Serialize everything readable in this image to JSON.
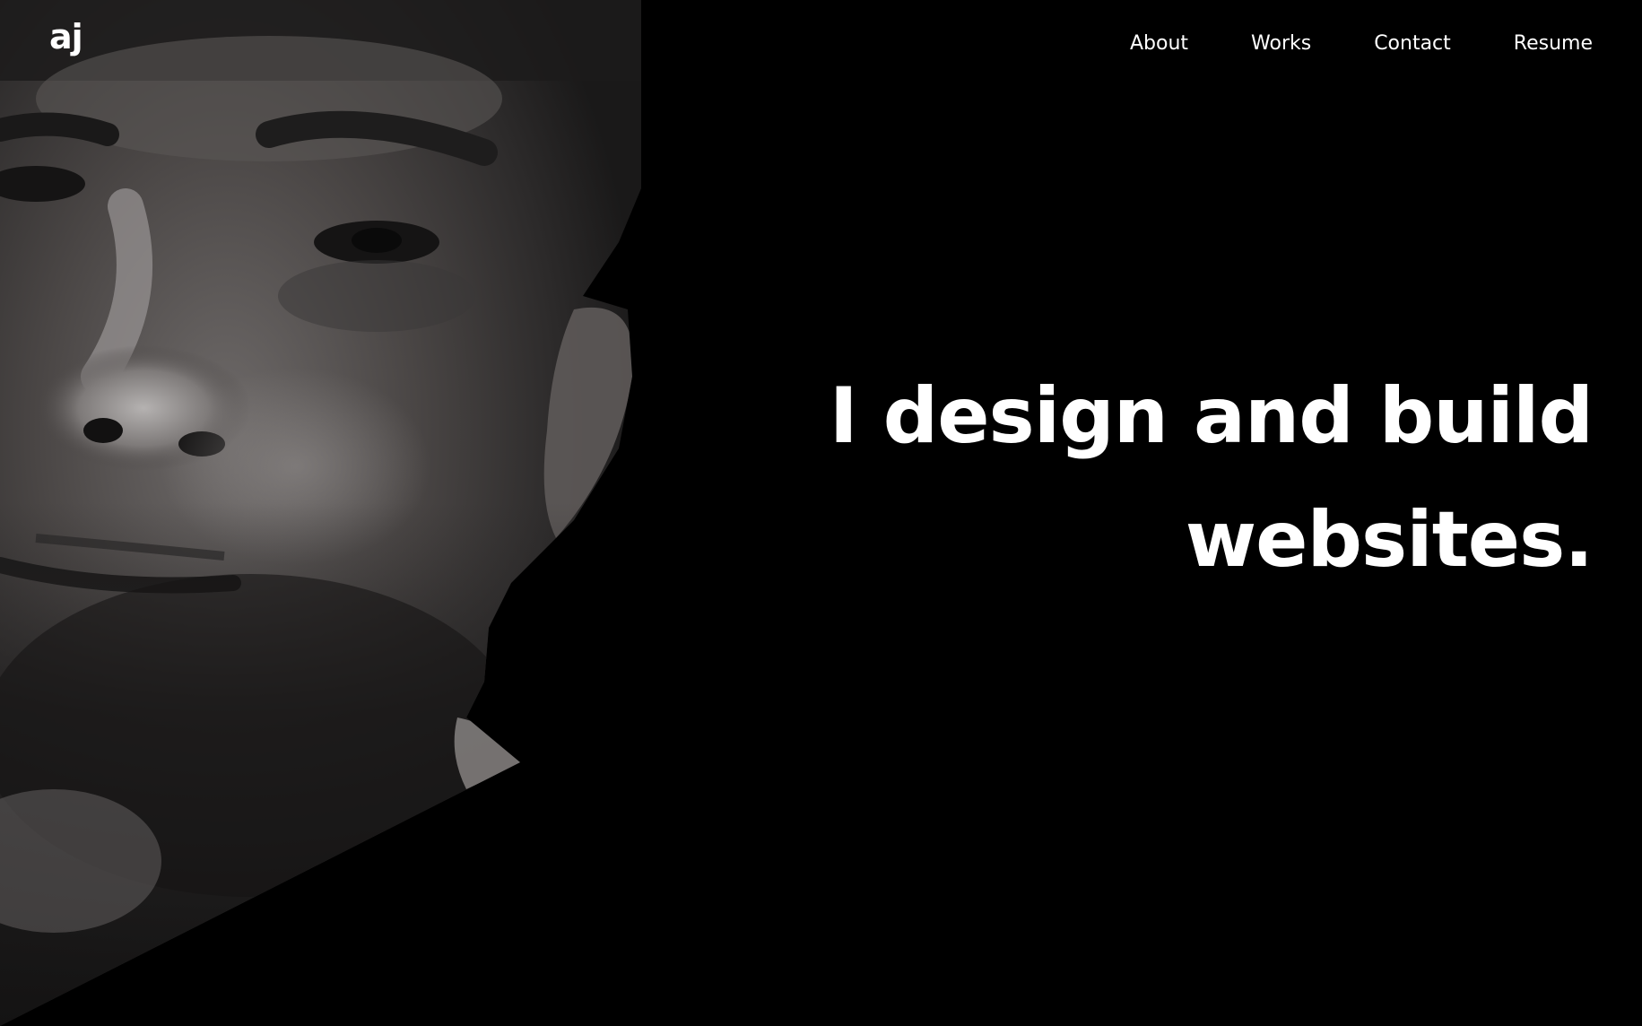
{
  "site": {
    "logo_text": "aj",
    "colors": {
      "background": "#000000",
      "text": "#ffffff"
    }
  },
  "nav": {
    "items": [
      {
        "label": "About"
      },
      {
        "label": "Works"
      },
      {
        "label": "Contact"
      },
      {
        "label": "Resume"
      }
    ]
  },
  "hero": {
    "line1": "I design and build",
    "line2": "websites."
  },
  "portrait": {
    "style": "grayscale photo of a man's face, cropped with diagonal edge"
  }
}
